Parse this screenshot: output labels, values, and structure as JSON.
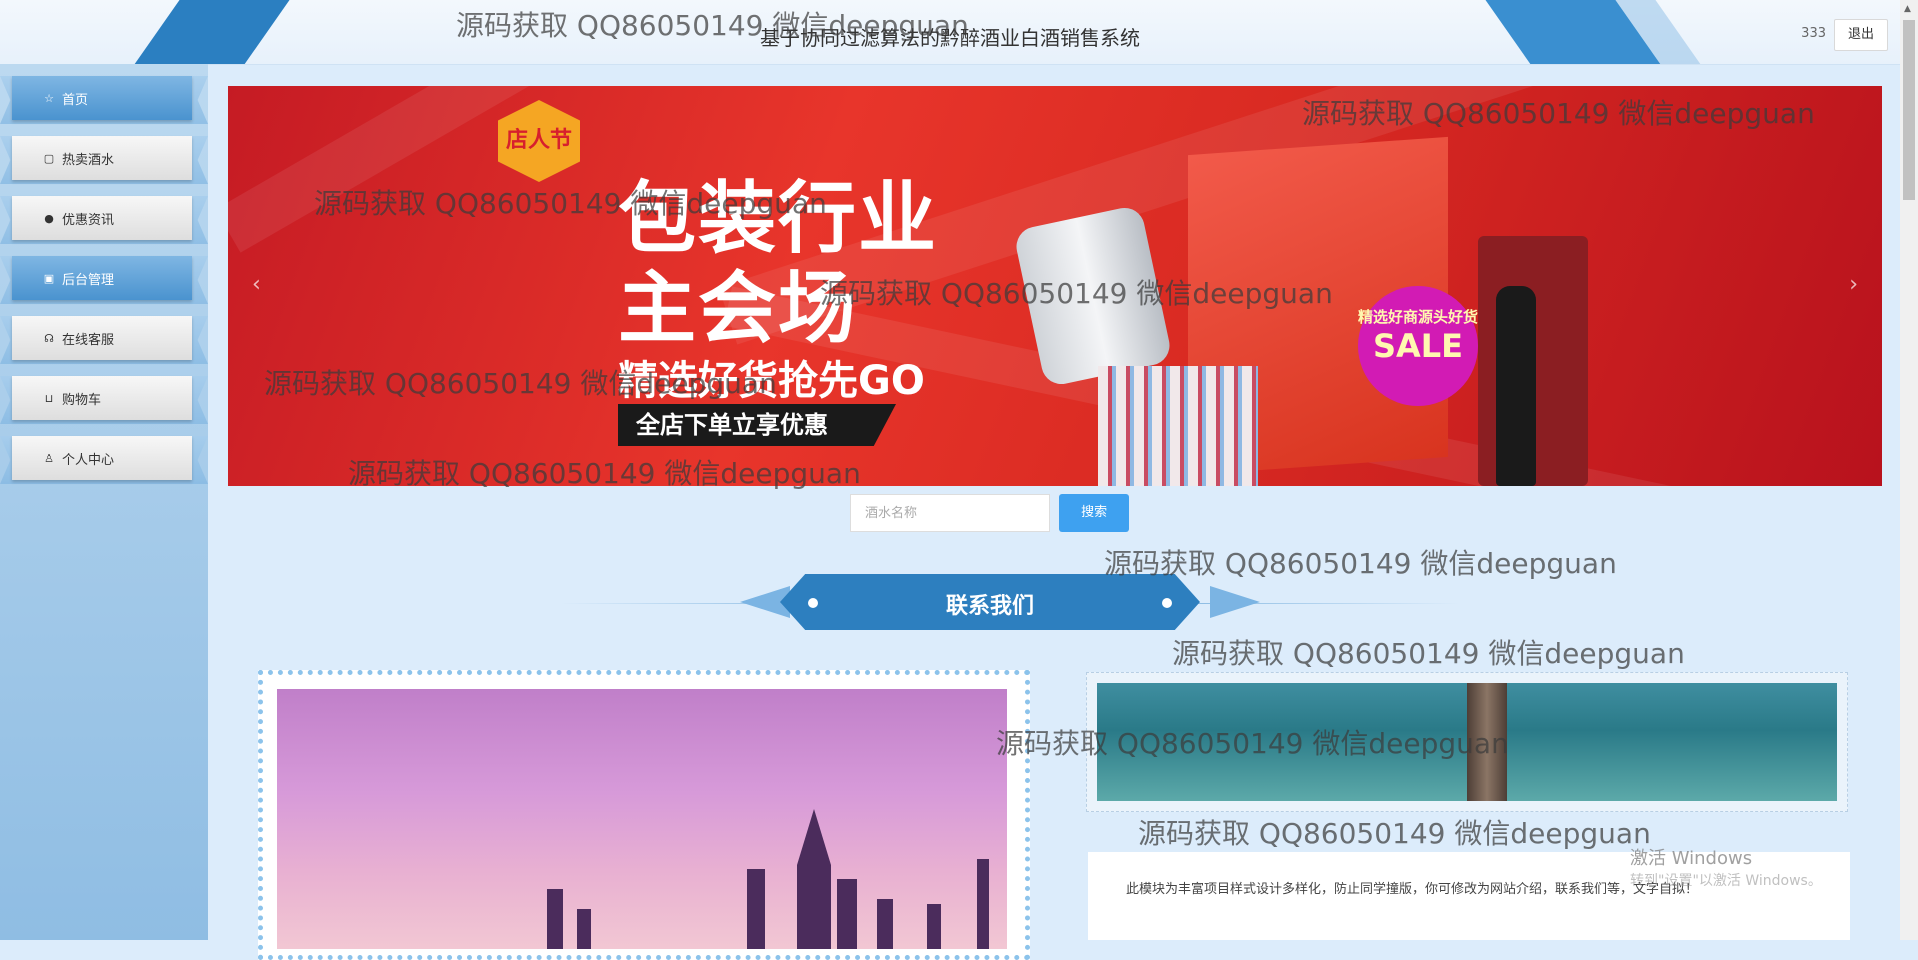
{
  "header": {
    "title": "基于协同过滤算法的黔醉酒业白酒销售系统",
    "user": "333",
    "logout": "退出"
  },
  "sidebar": {
    "items": [
      {
        "label": "首页",
        "icon": "star-icon"
      },
      {
        "label": "热卖酒水",
        "icon": "bag-icon"
      },
      {
        "label": "优惠资讯",
        "icon": "info-icon"
      },
      {
        "label": "后台管理",
        "icon": "box-icon"
      },
      {
        "label": "在线客服",
        "icon": "headset-icon"
      },
      {
        "label": "购物车",
        "icon": "cart-icon"
      },
      {
        "label": "个人中心",
        "icon": "user-icon"
      }
    ]
  },
  "banner": {
    "logo": "店人节",
    "line1": "包装行业",
    "line2": "主会场",
    "line3": "精选好货抢先GO",
    "line4": "全店下单立享优惠",
    "sale_small": "精选好商源头好货",
    "sale_big": "SALE",
    "prev": "‹",
    "next": "›"
  },
  "search": {
    "placeholder": "酒水名称",
    "button": "搜索"
  },
  "section": {
    "title": "联系我们"
  },
  "about": {
    "text": "此模块为丰富项目样式设计多样化，防止同学撞版，你可修改为网站介绍，联系我们等，文字自拟！"
  },
  "watermark": "源码获取 QQ86050149 微信deepguan",
  "windows": {
    "line1": "激活 Windows",
    "line2": "转到\"设置\"以激活 Windows。"
  }
}
